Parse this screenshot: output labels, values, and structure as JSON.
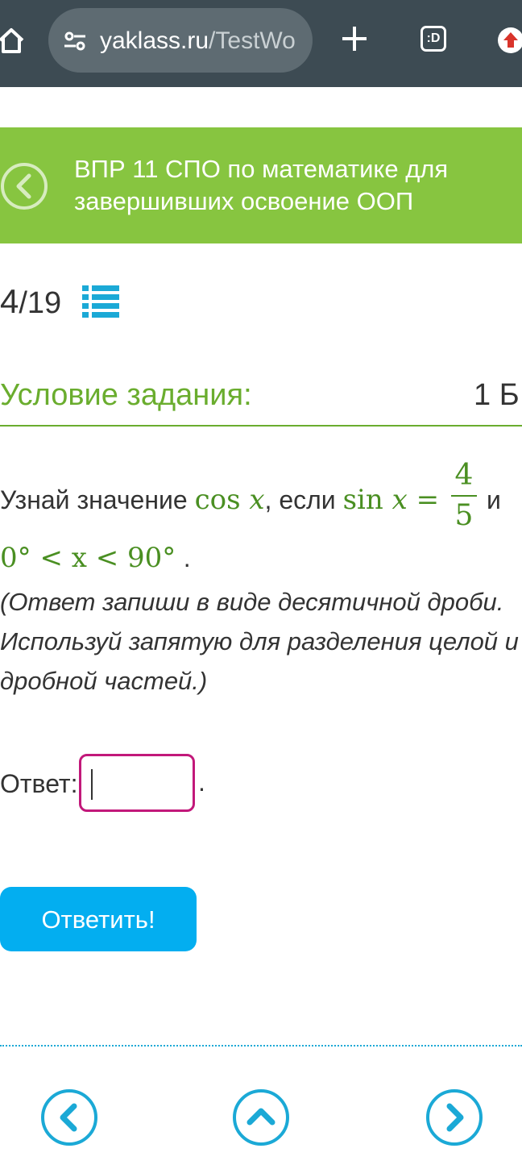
{
  "browser": {
    "url_host": "yaklass.ru",
    "url_path": "/TestWo",
    "tabs_icon_text": ":D"
  },
  "header": {
    "title": "ВПР 11 СПО по математике для завершивших освоение ООП"
  },
  "progress": {
    "current": "4",
    "separator_total": "/19"
  },
  "condition": {
    "title": "Условие задания:",
    "points": "1 Б."
  },
  "question": {
    "text_before": "Узнай значение ",
    "cos": "cos",
    "x": "x",
    "text_if": ", если ",
    "sin": "sin",
    "equals": "=",
    "frac_num": "4",
    "frac_den": "5",
    "text_and": "и",
    "range": "0° < x < 90°",
    "range_end": ".",
    "note": "(Ответ запиши в виде десятичной дроби. Используй запятую для разделения целой и дробной частей.)"
  },
  "answer": {
    "label": "Ответ:",
    "value": "",
    "after": "."
  },
  "submit_label": "Ответить!",
  "colors": {
    "toolbar": "#3d4b53",
    "header_green": "#87c540",
    "title_green": "#6aad2e",
    "math_green": "#4a8f22",
    "submit_blue": "#03aef0",
    "input_border": "#c2187a",
    "nav_blue": "#1ba9d6"
  },
  "icons": [
    "home-icon",
    "tune-icon",
    "plus-icon",
    "tabs-icon",
    "update-icon",
    "back-arrow-icon",
    "list-icon",
    "prev-icon",
    "up-icon",
    "next-icon"
  ]
}
